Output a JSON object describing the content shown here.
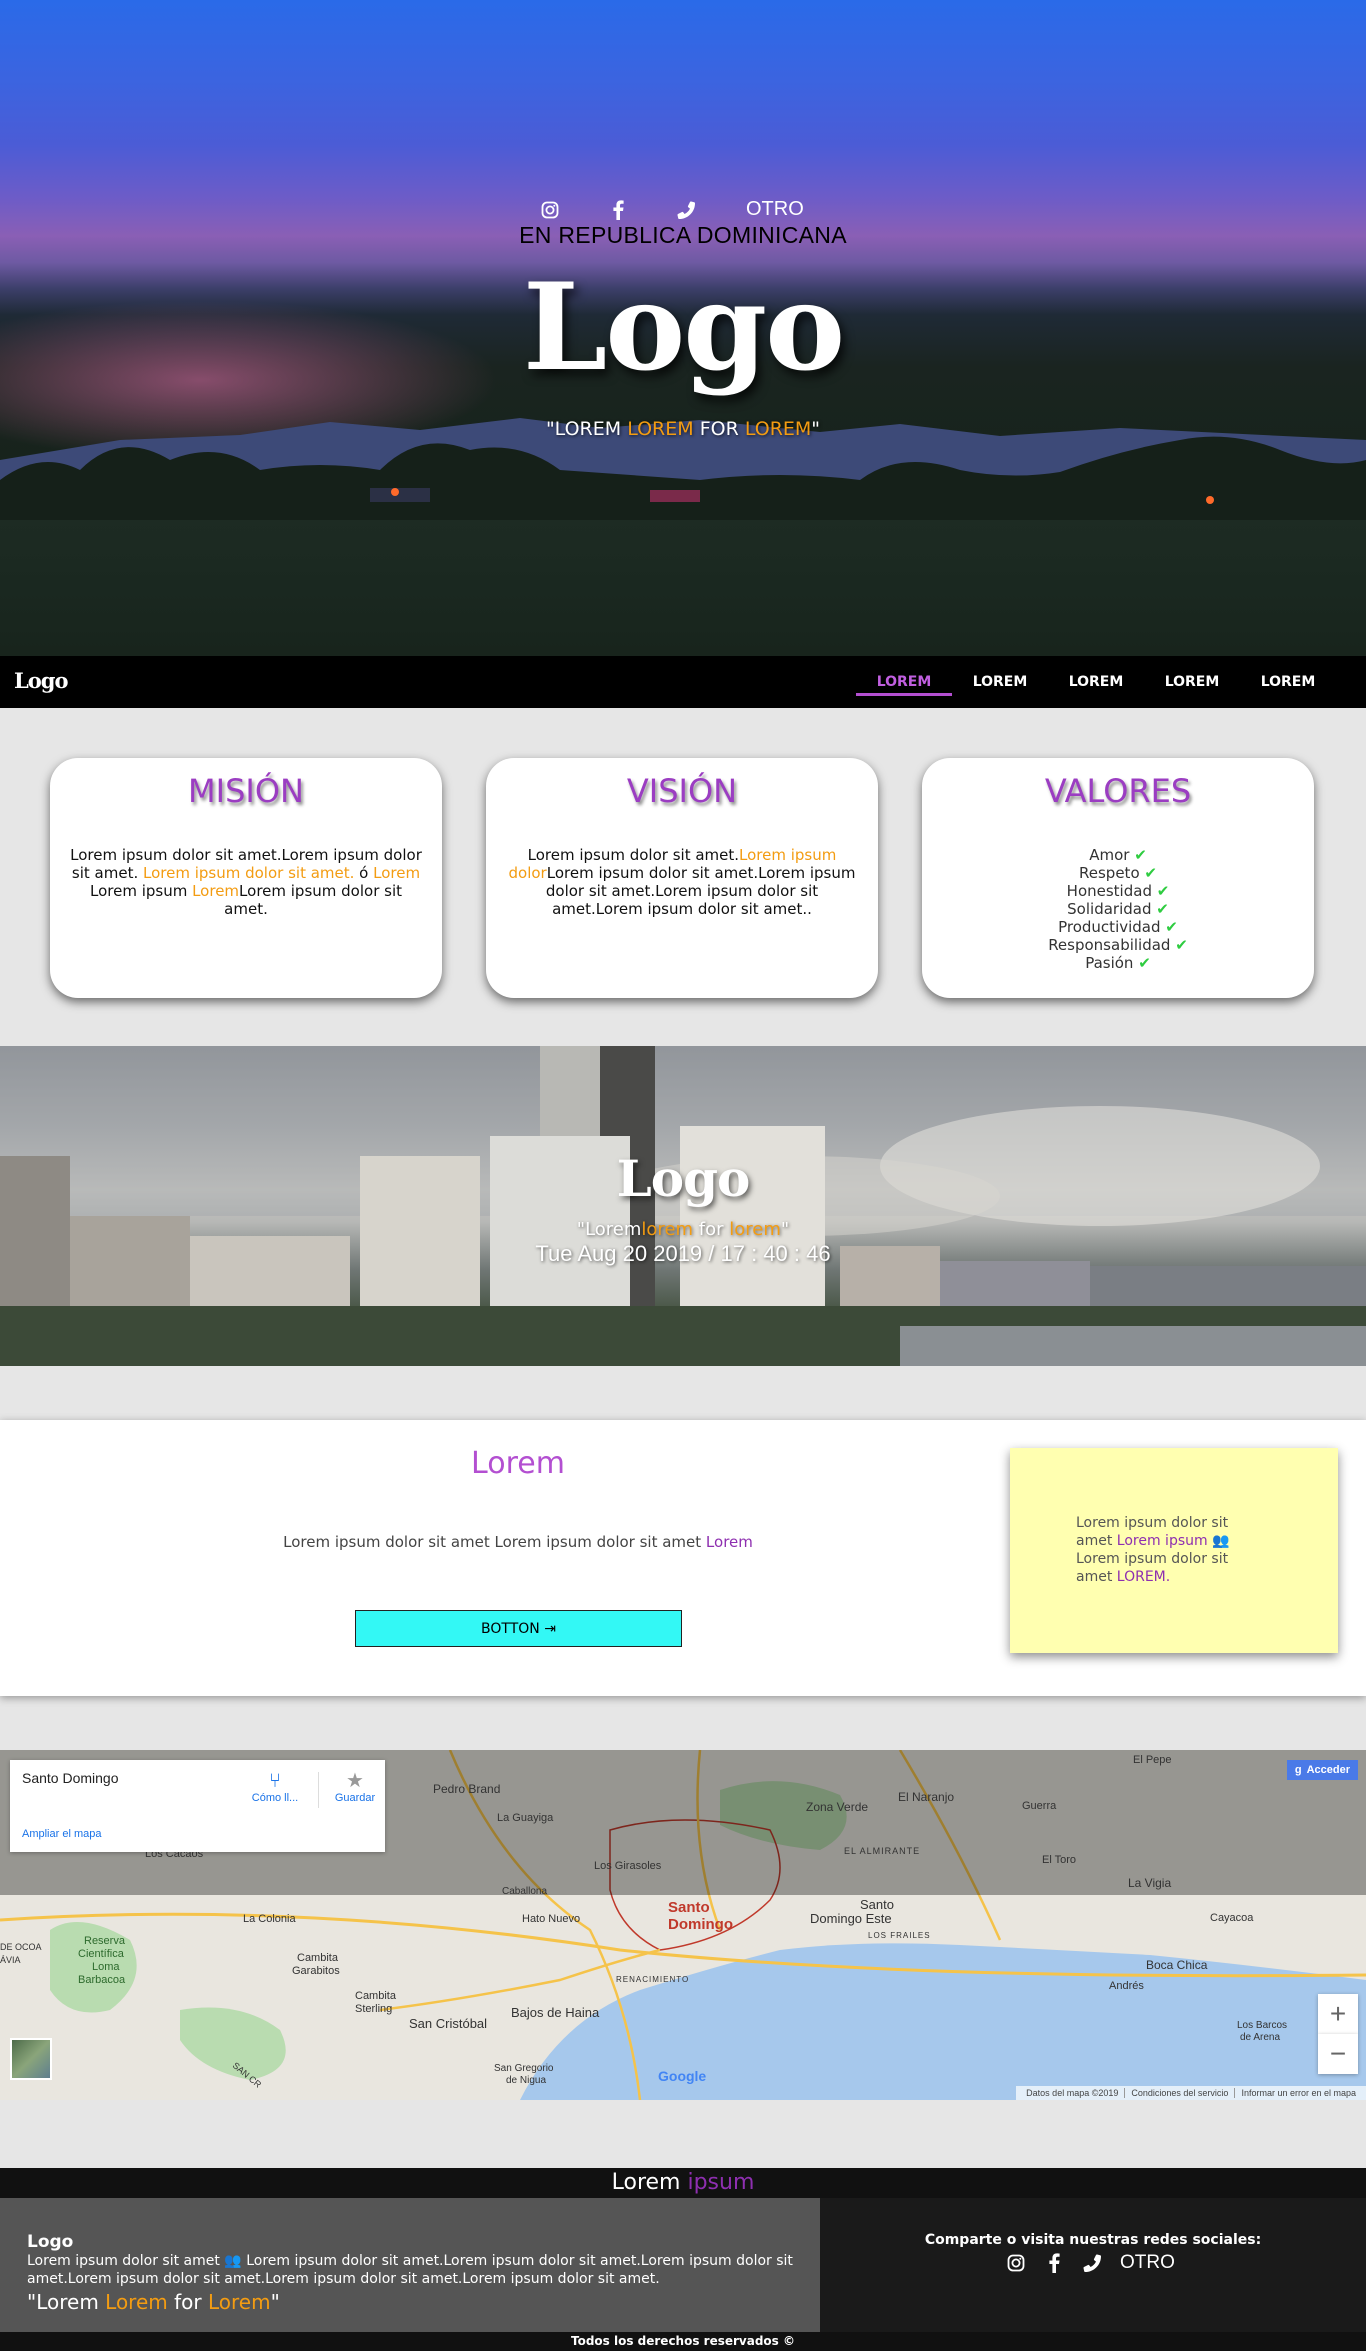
{
  "hero": {
    "social_other": "OTRO",
    "subtitle": "EN REPUBLICA DOMINICANA",
    "logo": "Logo",
    "slogan": {
      "q1": "\"LOREM ",
      "o1": "LOREM",
      "mid": " FOR ",
      "o2": "LOREM",
      "q2": "\""
    }
  },
  "navbar": {
    "logo": "Logo",
    "items": [
      "LOREM",
      "LOREM",
      "LOREM",
      "LOREM",
      "LOREM"
    ],
    "active_index": 0
  },
  "cards": {
    "mision": {
      "title": "MISIÓN",
      "t1": "Lorem ipsum dolor sit amet.Lorem ipsum dolor sit amet. ",
      "o1": "Lorem ipsum dolor sit amet.",
      "t2": " ó ",
      "o2": "Lorem",
      "t3": " Lorem ipsum ",
      "o3": "Lorem",
      "t4": "Lorem ipsum dolor sit amet."
    },
    "vision": {
      "title": "VISIÓN",
      "t1": "Lorem ipsum dolor sit amet.",
      "o1": "Lorem ipsum dolor",
      "t2": "Lorem ipsum dolor sit amet.Lorem ipsum dolor sit amet.Lorem ipsum dolor sit amet.Lorem ipsum dolor sit amet.."
    },
    "valores": {
      "title": "VALORES",
      "items": [
        "Amor",
        "Respeto",
        "Honestidad",
        "Solidaridad",
        "Productividad",
        "Responsabilidad",
        "Pasión"
      ]
    }
  },
  "city": {
    "logo": "Logo",
    "slogan": {
      "q1": "\"Lorem",
      "o1": "lorem",
      "mid": " for ",
      "o2": "lorem",
      "q2": "\""
    },
    "clock": "Tue Aug 20 2019 / 17 : 40 : 46"
  },
  "info": {
    "title": "Lorem",
    "text": "Lorem ipsum dolor sit amet Lorem ipsum dolor sit amet ",
    "text_link": "Lorem",
    "button": "BOTTON",
    "note": {
      "t1": "Lorem ipsum dolor sit amet ",
      "p1": "Lorem ipsum",
      "t2": " Lorem ipsum dolor sit amet ",
      "p2": "LOREM."
    }
  },
  "map": {
    "place": "Santo Domingo",
    "enlarge": "Ampliar el mapa",
    "directions": "Cómo ll...",
    "save": "Guardar",
    "login": "Acceder",
    "zoom_in": "+",
    "zoom_out": "−",
    "footer": [
      "Datos del mapa ©2019",
      "Condiciones del servicio",
      "Informar un error en el mapa"
    ],
    "labels": {
      "city_main_1": "Santo",
      "city_main_2": "Domingo",
      "sde_1": "Santo",
      "sde_2": "Domingo Este",
      "pedro_brand": "Pedro Brand",
      "la_guayiga": "La Guayiga",
      "zona_verde": "Zona Verde",
      "el_naranjo": "El Naranjo",
      "guerra": "Guerra",
      "el_pepe": "El Pepe",
      "los_girasoles": "Los Girasoles",
      "el_almirante": "EL ALMIRANTE",
      "el_toro": "El Toro",
      "la_vigia": "La Vigia",
      "los_cacaos": "Los Cacaos",
      "la_colonia": "La Colonia",
      "hato_nuevo": "Hato Nuevo",
      "caballona": "Caballona",
      "cayacoa": "Cayacoa",
      "los_frailes": "LOS FRAILES",
      "reserva_1": "Reserva",
      "reserva_2": "Científica",
      "reserva_3": "Loma",
      "reserva_4": "Barbacoa",
      "cambita_g_1": "Cambita",
      "cambita_g_2": "Garabitos",
      "cambita_s_1": "Cambita",
      "cambita_s_2": "Sterling",
      "san_cristobal": "San Cristóbal",
      "bajos": "Bajos de Haina",
      "renacimiento": "RENACIMIENTO",
      "boca_chica": "Boca Chica",
      "andres": "Andrés",
      "los_barcos_1": "Los Barcos",
      "los_barcos_2": "de Arena",
      "san_gregorio_1": "San Gregorio",
      "san_gregorio_2": "de Nigua",
      "san_cr_road": "SAN CR",
      "ocoa": "DE OCOA",
      "abava": "ÁVIA",
      "google": "Google"
    }
  },
  "footer": {
    "title_a": "Lorem ",
    "title_b": "ipsum",
    "logo": "Logo",
    "text_a": "Lorem ipsum dolor sit amet ",
    "text_b": " Lorem ipsum dolor sit amet.Lorem ipsum dolor sit amet.Lorem ipsum dolor sit amet.Lorem ipsum dolor sit amet.Lorem ipsum dolor sit amet.Lorem ipsum dolor sit amet.",
    "slogan": {
      "q1": "\"Lorem ",
      "o1": "Lorem",
      "mid": " for ",
      "o2": "Lorem",
      "q2": "\""
    },
    "share": "Comparte o visita nuestras redes sociales:",
    "social_other": "OTRO",
    "copyright": "Todos los derechos reservados ©"
  },
  "colors": {
    "accent_purple": "#b34fd1",
    "accent_orange": "#f39c12",
    "button_cyan": "#33f8f5",
    "note_yellow": "#ffffb0",
    "check_green": "#2ecc40"
  }
}
